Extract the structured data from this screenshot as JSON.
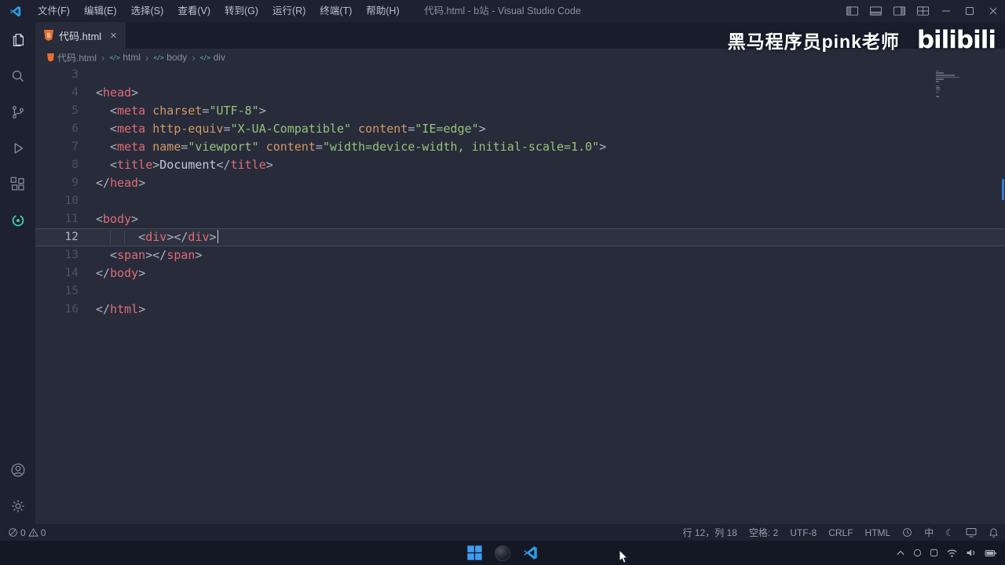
{
  "colors": {
    "accent_blue": "#2f9be6",
    "tag_red": "#e06c75",
    "attr_orange": "#d19a66",
    "string_green": "#98c379",
    "html_icon_orange": "#e6702e",
    "extension_teal": "#41c8a4",
    "overview_mark_blue": "#3a7bd5"
  },
  "title_bar": {
    "menus": [
      "文件(F)",
      "编辑(E)",
      "选择(S)",
      "查看(V)",
      "转到(G)",
      "运行(R)",
      "终端(T)",
      "帮助(H)"
    ],
    "title": "代码.html - b站 - Visual Studio Code"
  },
  "watermark": {
    "text": "黑马程序员pink老师",
    "logo": "bilibili"
  },
  "tab": {
    "label": "代码.html",
    "icon_text": "5",
    "close": "×"
  },
  "breadcrumb": {
    "items": [
      "代码.html",
      "html",
      "body",
      "div"
    ]
  },
  "editor": {
    "lines": [
      {
        "num": "3",
        "tokens": []
      },
      {
        "num": "4",
        "tokens": [
          [
            "p",
            "<"
          ],
          [
            "tag",
            "head"
          ],
          [
            "p",
            ">"
          ]
        ]
      },
      {
        "num": "5",
        "tokens": [
          [
            "p",
            "  <"
          ],
          [
            "tag",
            "meta"
          ],
          [
            "p",
            " "
          ],
          [
            "attr",
            "charset"
          ],
          [
            "p",
            "="
          ],
          [
            "str",
            "\"UTF-8\""
          ],
          [
            "p",
            ">"
          ]
        ]
      },
      {
        "num": "6",
        "tokens": [
          [
            "p",
            "  <"
          ],
          [
            "tag",
            "meta"
          ],
          [
            "p",
            " "
          ],
          [
            "attr",
            "http-equiv"
          ],
          [
            "p",
            "="
          ],
          [
            "str",
            "\"X-UA-Compatible\""
          ],
          [
            "p",
            " "
          ],
          [
            "attr",
            "content"
          ],
          [
            "p",
            "="
          ],
          [
            "str",
            "\"IE=edge\""
          ],
          [
            "p",
            ">"
          ]
        ]
      },
      {
        "num": "7",
        "tokens": [
          [
            "p",
            "  <"
          ],
          [
            "tag",
            "meta"
          ],
          [
            "p",
            " "
          ],
          [
            "attr",
            "name"
          ],
          [
            "p",
            "="
          ],
          [
            "str",
            "\"viewport\""
          ],
          [
            "p",
            " "
          ],
          [
            "attr",
            "content"
          ],
          [
            "p",
            "="
          ],
          [
            "str",
            "\"width=device-width, initial-scale=1.0\""
          ],
          [
            "p",
            ">"
          ]
        ]
      },
      {
        "num": "8",
        "tokens": [
          [
            "p",
            "  <"
          ],
          [
            "tag",
            "title"
          ],
          [
            "p",
            ">"
          ],
          [
            "txt",
            "Document"
          ],
          [
            "p",
            "</"
          ],
          [
            "tag",
            "title"
          ],
          [
            "p",
            ">"
          ]
        ]
      },
      {
        "num": "9",
        "tokens": [
          [
            "p",
            "</"
          ],
          [
            "tag",
            "head"
          ],
          [
            "p",
            ">"
          ]
        ]
      },
      {
        "num": "10",
        "tokens": []
      },
      {
        "num": "11",
        "tokens": [
          [
            "p",
            "<"
          ],
          [
            "tag",
            "body"
          ],
          [
            "p",
            ">"
          ]
        ]
      },
      {
        "num": "12",
        "active": true,
        "cursor": true,
        "guides": [
          2,
          4
        ],
        "tokens": [
          [
            "p",
            "      <"
          ],
          [
            "tag",
            "div"
          ],
          [
            "p",
            "></"
          ],
          [
            "tag",
            "div"
          ],
          [
            "p",
            ">"
          ]
        ]
      },
      {
        "num": "13",
        "tokens": [
          [
            "p",
            "  <"
          ],
          [
            "tag",
            "span"
          ],
          [
            "p",
            "></"
          ],
          [
            "tag",
            "span"
          ],
          [
            "p",
            ">"
          ]
        ]
      },
      {
        "num": "14",
        "tokens": [
          [
            "p",
            "</"
          ],
          [
            "tag",
            "body"
          ],
          [
            "p",
            ">"
          ]
        ]
      },
      {
        "num": "15",
        "tokens": []
      },
      {
        "num": "16",
        "tokens": [
          [
            "p",
            "</"
          ],
          [
            "tag",
            "html"
          ],
          [
            "p",
            ">"
          ]
        ]
      }
    ]
  },
  "status_bar": {
    "errors": "0",
    "warnings": "0",
    "line_col": "行 12，列 18",
    "spaces": "空格: 2",
    "encoding": "UTF-8",
    "eol": "CRLF",
    "language": "HTML",
    "ime": "中"
  }
}
